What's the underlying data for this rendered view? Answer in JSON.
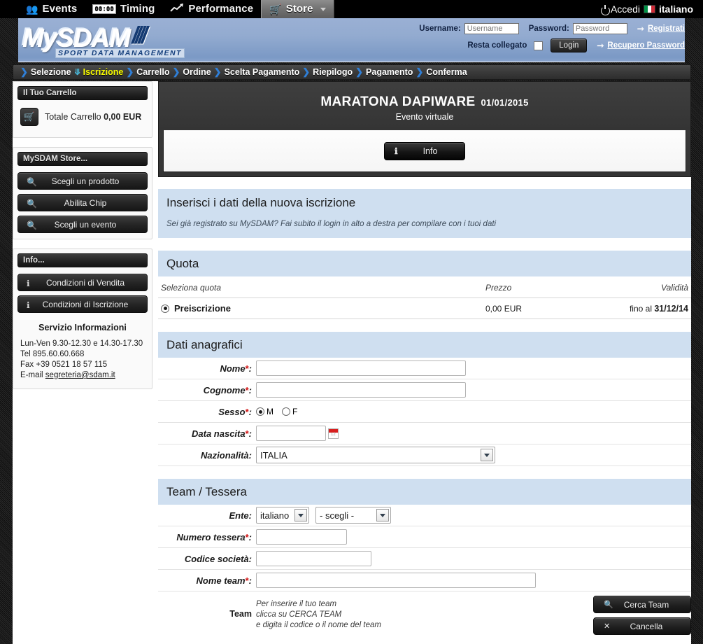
{
  "topnav": {
    "items": [
      {
        "label": "Events",
        "icon": "people-icon",
        "active": false
      },
      {
        "label": "Timing",
        "icon": "stopwatch-icon",
        "active": false
      },
      {
        "label": "Performance",
        "icon": "chart-icon",
        "active": false
      },
      {
        "label": "Store",
        "icon": "cart-icon",
        "active": true
      }
    ],
    "accedi_label": "Accedi",
    "accedi_icon": "power-icon",
    "language": "italiano",
    "flag_icon": "italy-flag-icon"
  },
  "header": {
    "logo_main": "MySDAM",
    "logo_sub": "SPORT DATA MANAGEMENT",
    "login": {
      "username_label": "Username:",
      "username_placeholder": "Username",
      "username_value": "",
      "password_label": "Password:",
      "password_placeholder": "Password",
      "password_value": "",
      "remember_label": "Resta collegato",
      "login_button": "Login",
      "register_link": "Registrati",
      "recover_link": "Recupero Password"
    }
  },
  "steps": [
    {
      "label": "Selezione",
      "current": false
    },
    {
      "label": "Iscrizione",
      "current": true
    },
    {
      "label": "Carrello",
      "current": false
    },
    {
      "label": "Ordine",
      "current": false
    },
    {
      "label": "Scelta Pagamento",
      "current": false
    },
    {
      "label": "Riepilogo",
      "current": false
    },
    {
      "label": "Pagamento",
      "current": false
    },
    {
      "label": "Conferma",
      "current": false
    }
  ],
  "sidebar": {
    "cart": {
      "title": "Il Tuo Carrello",
      "icon": "cart-icon",
      "total_label": "Totale Carrello",
      "total_value": "0,00 EUR"
    },
    "store": {
      "title": "MySDAM Store...",
      "buttons": [
        {
          "label": "Scegli un prodotto",
          "icon": "search-icon"
        },
        {
          "label": "Abilita Chip",
          "icon": "search-icon"
        },
        {
          "label": "Scegli un evento",
          "icon": "search-icon"
        }
      ]
    },
    "info": {
      "title": "Info...",
      "buttons": [
        {
          "label": "Condizioni di Vendita",
          "icon": "info-icon"
        },
        {
          "label": "Condizioni di Iscrizione",
          "icon": "info-icon"
        }
      ]
    },
    "service": {
      "title": "Servizio Informazioni",
      "hours": "Lun-Ven 9.30-12.30 e 14.30-17.30",
      "tel": "Tel 895.60.60.668",
      "fax": "Fax +39 0521 18 57 115",
      "email_label": "E-mail",
      "email": "segreteria@sdam.it"
    }
  },
  "main": {
    "event": {
      "title": "MARATONA DAPIWARE",
      "date": "01/01/2015",
      "subtitle": "Evento virtuale",
      "info_button": "Info",
      "info_icon": "info-icon"
    },
    "intro": {
      "title": "Inserisci i dati della nuova iscrizione",
      "hint": "Sei già registrato su MySDAM? Fai subito il login in alto a destra per compilare con i tuoi dati"
    },
    "quota": {
      "section_title": "Quota",
      "headers": {
        "name": "Seleziona quota",
        "price": "Prezzo",
        "validity": "Validità"
      },
      "rows": [
        {
          "name": "Preiscrizione",
          "price": "0,00 EUR",
          "validity_prefix": "fino al ",
          "validity_date": "31/12/14",
          "selected": true
        }
      ]
    },
    "anagrafici": {
      "section_title": "Dati anagrafici",
      "fields": {
        "nome_label": "Nome",
        "nome_value": "",
        "cognome_label": "Cognome",
        "cognome_value": "",
        "sesso_label": "Sesso",
        "sesso_m": "M",
        "sesso_f": "F",
        "sesso_selected": "M",
        "data_label": "Data nascita",
        "data_value": "",
        "calendar_icon": "calendar-icon",
        "nazionalita_label": "Nazionalità",
        "nazionalita_value": "ITALIA"
      }
    },
    "team": {
      "section_title": "Team / Tessera",
      "ente_label": "Ente",
      "ente_value": "italiano",
      "ente_scegli_value": "- scegli -",
      "tessera_label": "Numero tessera",
      "tessera_value": "",
      "codice_label": "Codice società",
      "codice_value": "",
      "nometeam_label": "Nome team",
      "nometeam_value": "",
      "team_label": "Team",
      "note_line1": "Per inserire il tuo team",
      "note_line2": "clicca su CERCA TEAM",
      "note_line3": "e digita il codice o il nome del team",
      "cerca_button": "Cerca Team",
      "cerca_icon": "search-icon",
      "cancella_button": "Cancella",
      "cancella_icon": "close-icon"
    }
  },
  "colors": {
    "header_blue": "#93abd0",
    "section_blue": "#cfdff0",
    "accent_yellow": "#fbff00",
    "required_red": "#d01010"
  }
}
